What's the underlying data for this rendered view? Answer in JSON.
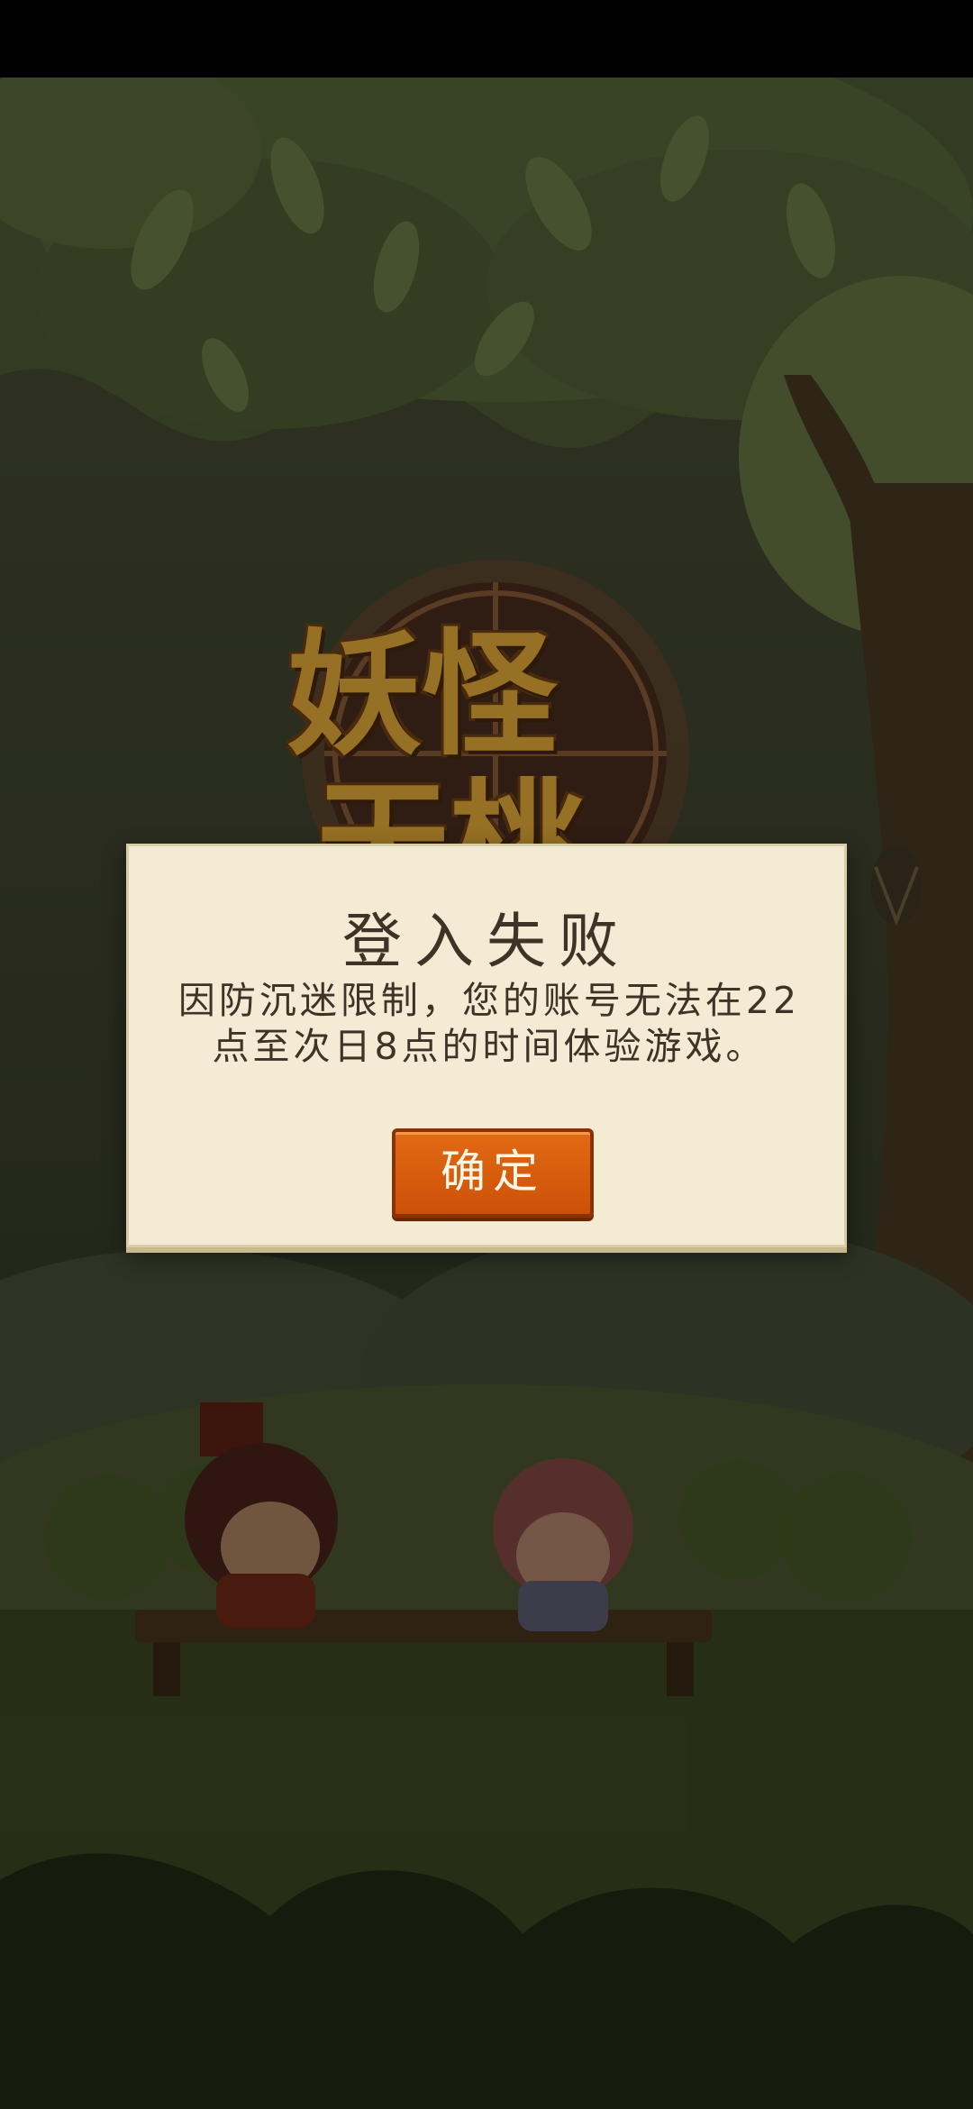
{
  "game": {
    "logo_top": "妖怪",
    "logo_bottom": "天桃"
  },
  "dialog": {
    "title": "登入失败",
    "message": "因防沉迷限制，您的账号无法在22点至次日8点的时间体验游戏。",
    "confirm_label": "确定"
  },
  "colors": {
    "button": "#d85c10",
    "dialog_background": "#f3ebd4",
    "text": "#3d3428"
  }
}
